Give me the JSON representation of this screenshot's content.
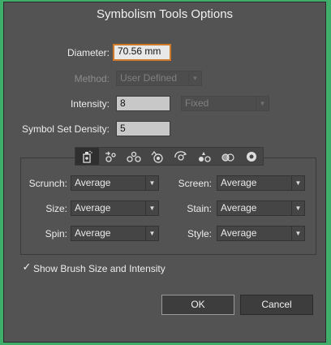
{
  "window": {
    "title": "Symbolism Tools Options"
  },
  "fields": {
    "diameter_label": "Diameter:",
    "diameter_value": "70.56 mm",
    "method_label": "Method:",
    "method_value": "User Defined",
    "intensity_label": "Intensity:",
    "intensity_value": "8",
    "intensity_mode": "Fixed",
    "density_label": "Symbol Set Density:",
    "density_value": "5"
  },
  "tools": [
    {
      "name": "symbol-sprayer"
    },
    {
      "name": "symbol-shifter"
    },
    {
      "name": "symbol-scruncher"
    },
    {
      "name": "symbol-sizer"
    },
    {
      "name": "symbol-spinner"
    },
    {
      "name": "symbol-stainer"
    },
    {
      "name": "symbol-screener"
    },
    {
      "name": "symbol-styler"
    }
  ],
  "options": {
    "scrunch_label": "Scrunch:",
    "scrunch_value": "Average",
    "screen_label": "Screen:",
    "screen_value": "Average",
    "size_label": "Size:",
    "size_value": "Average",
    "stain_label": "Stain:",
    "stain_value": "Average",
    "spin_label": "Spin:",
    "spin_value": "Average",
    "style_label": "Style:",
    "style_value": "Average"
  },
  "show_brush": {
    "label": "Show Brush Size and Intensity",
    "checked": true,
    "mark": "✓"
  },
  "buttons": {
    "ok": "OK",
    "cancel": "Cancel"
  },
  "colors": {
    "accent_focus": "#d07a29",
    "dialog_bg": "#535353",
    "backdrop": "#3fae6b"
  }
}
